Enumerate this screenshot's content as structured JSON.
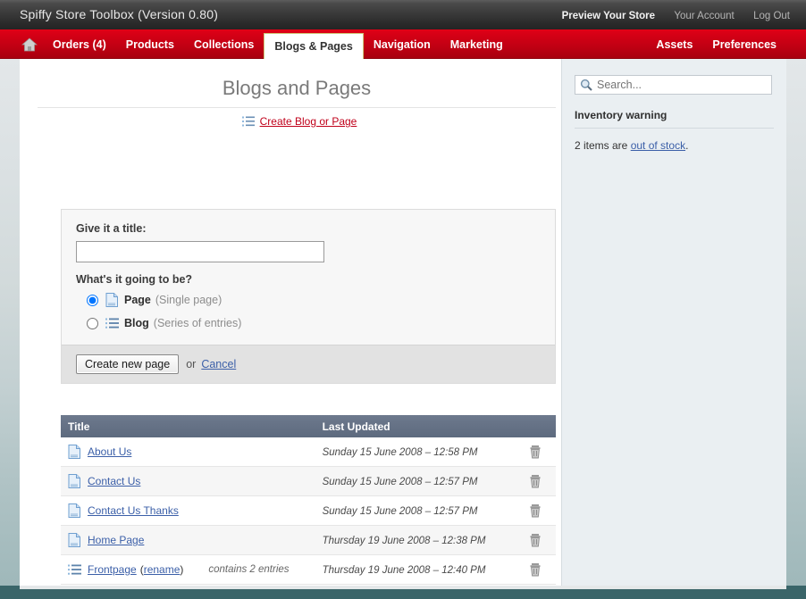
{
  "topbar": {
    "title": "Spiffy Store Toolbox (Version 0.80)",
    "links": [
      {
        "label": "Preview Your Store",
        "strong": true
      },
      {
        "label": "Your Account",
        "strong": false
      },
      {
        "label": "Log Out",
        "strong": false
      }
    ]
  },
  "nav": {
    "home_icon": "home-icon",
    "left_items": [
      {
        "label": "Orders (4)",
        "active": false
      },
      {
        "label": "Products",
        "active": false
      },
      {
        "label": "Collections",
        "active": false
      },
      {
        "label": "Blogs & Pages",
        "active": true
      },
      {
        "label": "Navigation",
        "active": false
      },
      {
        "label": "Marketing",
        "active": false
      }
    ],
    "right_items": [
      {
        "label": "Assets"
      },
      {
        "label": "Preferences"
      }
    ]
  },
  "main": {
    "page_title": "Blogs and Pages",
    "create_link": "Create Blog or Page",
    "create_link_icon": "list-icon",
    "form": {
      "title_label": "Give it a title:",
      "title_value": "",
      "title_placeholder": "",
      "type_label": "What's it going to be?",
      "options": [
        {
          "name": "Page",
          "desc": "(Single page)",
          "icon": "page-icon",
          "checked": true
        },
        {
          "name": "Blog",
          "desc": "(Series of entries)",
          "icon": "list-icon",
          "checked": false
        }
      ],
      "submit_label": "Create new page",
      "or_label": "or",
      "cancel_label": "Cancel"
    },
    "table": {
      "columns": [
        "Title",
        "Last Updated",
        ""
      ],
      "rows": [
        {
          "icon": "page-icon",
          "title": "About Us",
          "rename": "",
          "entries": "",
          "updated": "Sunday 15 June 2008 – 12:58 PM",
          "delete_icon": "trash-icon"
        },
        {
          "icon": "page-icon",
          "title": "Contact Us",
          "rename": "",
          "entries": "",
          "updated": "Sunday 15 June 2008 – 12:57 PM",
          "delete_icon": "trash-icon"
        },
        {
          "icon": "page-icon",
          "title": "Contact Us Thanks",
          "rename": "",
          "entries": "",
          "updated": "Sunday 15 June 2008 – 12:57 PM",
          "delete_icon": "trash-icon"
        },
        {
          "icon": "page-icon",
          "title": "Home Page",
          "rename": "",
          "entries": "",
          "updated": "Thursday 19 June 2008 – 12:38 PM",
          "delete_icon": "trash-icon"
        },
        {
          "icon": "list-icon",
          "title": "Frontpage",
          "rename": "rename",
          "entries": "contains 2 entries",
          "updated": "Thursday 19 June 2008 – 12:40 PM",
          "delete_icon": "trash-icon"
        }
      ]
    }
  },
  "sidebar": {
    "search_placeholder": "Search...",
    "search_value": "",
    "search_icon": "magnifier-icon",
    "warning_heading": "Inventory warning",
    "warning_prefix": "2 items are ",
    "warning_link": "out of stock",
    "warning_suffix": "."
  },
  "colors": {
    "brand_red": "#c0001a",
    "nav_red": "#d20015",
    "link_blue": "#3b5fa8",
    "page_bg": "#3a6569",
    "sidebar_bg": "#eaeff2",
    "table_header": "#5d6a7e"
  }
}
